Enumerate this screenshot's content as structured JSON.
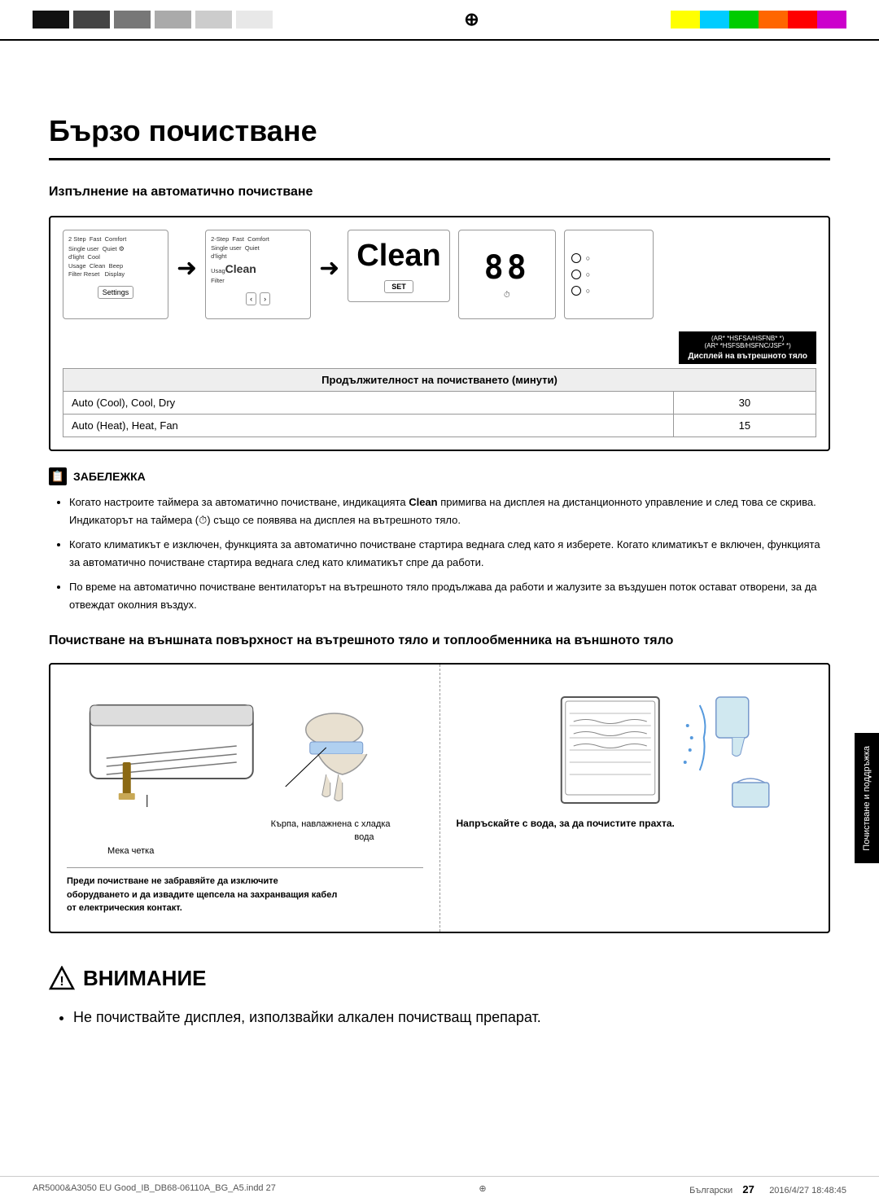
{
  "top": {
    "color_blocks_left": [
      "#1a1a1a",
      "#3a3a3a",
      "#666",
      "#aaa",
      "#ccc",
      "#e5e5e5"
    ],
    "color_blocks_right": [
      "#ffff00",
      "#00ccff",
      "#00cc00",
      "#ff6600",
      "#ff0000",
      "#cc00cc"
    ],
    "compass": "⊕"
  },
  "page": {
    "title": "Бързо почистване",
    "section1_title": "Изпълнение на автоматично почистване",
    "clean_label": "Clean",
    "display_label": "Дисплей на вътрешното тяло",
    "inner_label_1": "(AR* *HSFSA/HSFNB* *)",
    "inner_label_2": "(AR* *HSFSB/HSFNC/JSF* *)",
    "duration_header": "Продължителност на почистването (минути)",
    "duration_rows": [
      {
        "mode": "Auto (Cool), Cool, Dry",
        "minutes": "30"
      },
      {
        "mode": "Auto (Heat), Heat, Fan",
        "minutes": "15"
      }
    ],
    "note_label": "ЗАБЕЛЕЖКА",
    "note_items": [
      "Когато настроите таймера за автоматично почистване, индикацията Clean примигва на дисплея на дистанционното управление и след това се скрива. Индикаторът на таймера (⏱) също се появява на дисплея на вътрешното тяло.",
      "Когато климатикът е изключен, функцията за автоматично почистване стартира веднага след като я изберете. Когато климатикът е включен, функцията за автоматично почистване стартира веднага след като климатикът спре да работи.",
      "По време на автоматично почистване вентилаторът на вътрешното тяло продължава да работи и жалузите за въздушен поток остават отворени, за да отвеждат околния въздух."
    ],
    "section2_title": "Почистване на външната повърхност на вътрешното тяло и топлообменника на външното тяло",
    "illus_left_label1": "Кърпа, навлажнена с хладка",
    "illus_left_label2": "вода",
    "illus_left_label3": "Мека четка",
    "illus_left_warning": "Преди почистване не забравяйте да изключите оборудването и да извадите щепсела на захранващия кабел от електрическия контакт.",
    "illus_right_caption": "Напръскайте с вода, за да почистите прахта.",
    "warning_title": "ВНИМАНИЕ",
    "warning_items": [
      "Не почиствайте дисплея, използвайки алкален почистващ препарат."
    ],
    "side_tab_text": "Почистване и поддръжка",
    "footer_left": "AR5000&A3050 EU Good_IB_DB68-06110A_BG_A5.indd   27",
    "footer_compass": "⊕",
    "footer_date": "2016/4/27   18:48:45",
    "footer_lang": "Български",
    "footer_page": "27",
    "remote_text_1": "2 Step  Fast  Comfort\nSingle user  Quiet\nd'light  Cool\nUsage  Clean  Beep\nFilter Reset   Display",
    "remote_text_2": "2-Step  Fast  Comfort\nSingle user  Quiet\nd'light\nUsage  Clean  Filter\nFilter",
    "settings_btn": "Settings",
    "nav_left": "‹",
    "nav_right": "›",
    "set_btn": "SET"
  }
}
